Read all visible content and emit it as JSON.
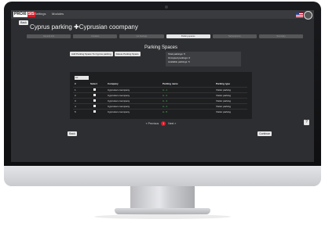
{
  "topbar": {
    "logo_left": "PROXI",
    "logo_right": "SIS",
    "nav": [
      "Settings",
      "Modules"
    ]
  },
  "header": {
    "back_label": "Back",
    "title": "Cyprus parking ✚Cyprusian coompany"
  },
  "steps": [
    "General info",
    "Contacts",
    "Lot Settings",
    "Parking spaces",
    "Subscriptions",
    "Summary"
  ],
  "active_step": 3,
  "panel": {
    "title": "Parking Spaces",
    "actions": [
      "Add Parking Space To Cyprus parking",
      "Delete Parking Space"
    ],
    "stats": [
      "Total parkings: 5",
      "Occupied parkings: 0",
      "Available parkings: 5"
    ]
  },
  "table": {
    "page_size": "10",
    "columns": [
      "#",
      "Select",
      "Company",
      "Parking name",
      "Parking type"
    ],
    "rows": [
      {
        "num": "1",
        "company": "Cyprusian coompany",
        "name": "A - 1",
        "type": "Visitor parking"
      },
      {
        "num": "2",
        "company": "Cyprusian coompany",
        "name": "A - 2",
        "type": "Visitor parking"
      },
      {
        "num": "3",
        "company": "Cyprusian coompany",
        "name": "A - 3",
        "type": "Visitor parking"
      },
      {
        "num": "4",
        "company": "Cyprusian coompany",
        "name": "A - 4",
        "type": "Visitor parking"
      },
      {
        "num": "5",
        "company": "Cyprusian coompany",
        "name": "A - 5",
        "type": "Visitor parking"
      }
    ]
  },
  "pager": {
    "prev": "« Previous",
    "current": "1",
    "next": "Next »"
  },
  "footer": {
    "back": "Back",
    "continue": "Continue"
  },
  "help_icon": "?",
  "colors": {
    "accent": "#d31d2a",
    "parking_name": "#4ec55a"
  }
}
